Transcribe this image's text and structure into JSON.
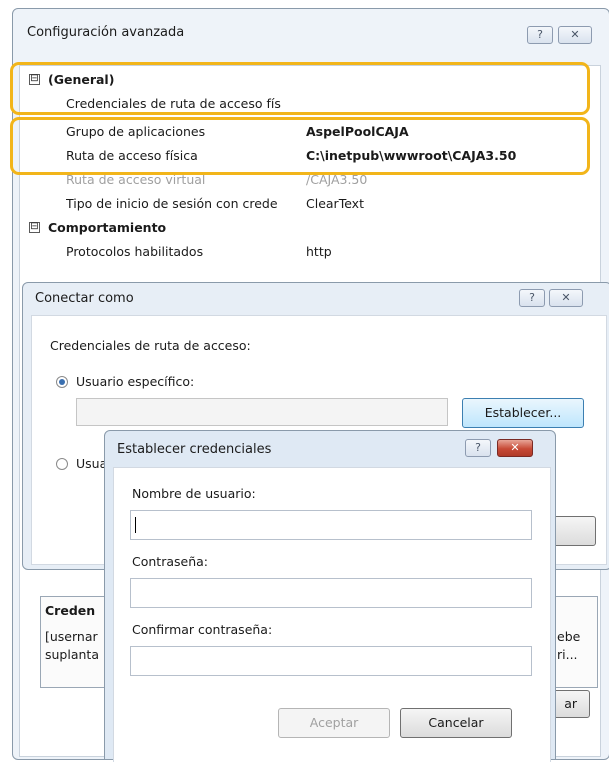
{
  "advanced": {
    "title": "Configuración avanzada",
    "help_glyph": "?",
    "close_glyph": "✕",
    "general_section": "(General)",
    "behavior_section": "Comportamiento",
    "expander_glyph": "⊟",
    "properties": [
      {
        "name": "Credenciales de ruta de acceso fís",
        "value": ""
      },
      {
        "name": "Grupo de aplicaciones",
        "value": "AspelPoolCAJA"
      },
      {
        "name": "Ruta de acceso física",
        "value": "C:\\inetpub\\wwwroot\\CAJA3.50"
      },
      {
        "name": "Ruta de acceso virtual",
        "value": "/CAJA3.50"
      },
      {
        "name": "Tipo de inicio de sesión con crede",
        "value": "ClearText"
      },
      {
        "name": "Protocolos habilitados",
        "value": "http"
      }
    ],
    "desc_title_partial": "Creden",
    "desc_text_line1_partial": "[usernar",
    "desc_text_line2_partial": "suplanta",
    "right_fragment_1": "ebe",
    "right_fragment_2": "ri...",
    "bottom_right_fragment": "ar"
  },
  "connect_as": {
    "title": "Conectar como",
    "help_glyph": "?",
    "close_glyph": "✕",
    "credentials_label": "Credenciales de ruta de acceso:",
    "specific_user_label": "Usuario específico:",
    "set_button": "Establecer...",
    "other_option_partial": "Usua"
  },
  "set_credentials": {
    "title": "Establecer credenciales",
    "help_glyph": "?",
    "close_glyph": "✕",
    "username_label": "Nombre de usuario:",
    "username_value": "",
    "password_label": "Contraseña:",
    "confirm_label": "Confirmar contraseña:",
    "ok_button": "Aceptar",
    "cancel_button": "Cancelar"
  },
  "colors": {
    "highlight": "#f2b51a",
    "window_body": "#ffffff",
    "close_red": "#c74a36",
    "disabled_text": "#a0a0a0"
  }
}
